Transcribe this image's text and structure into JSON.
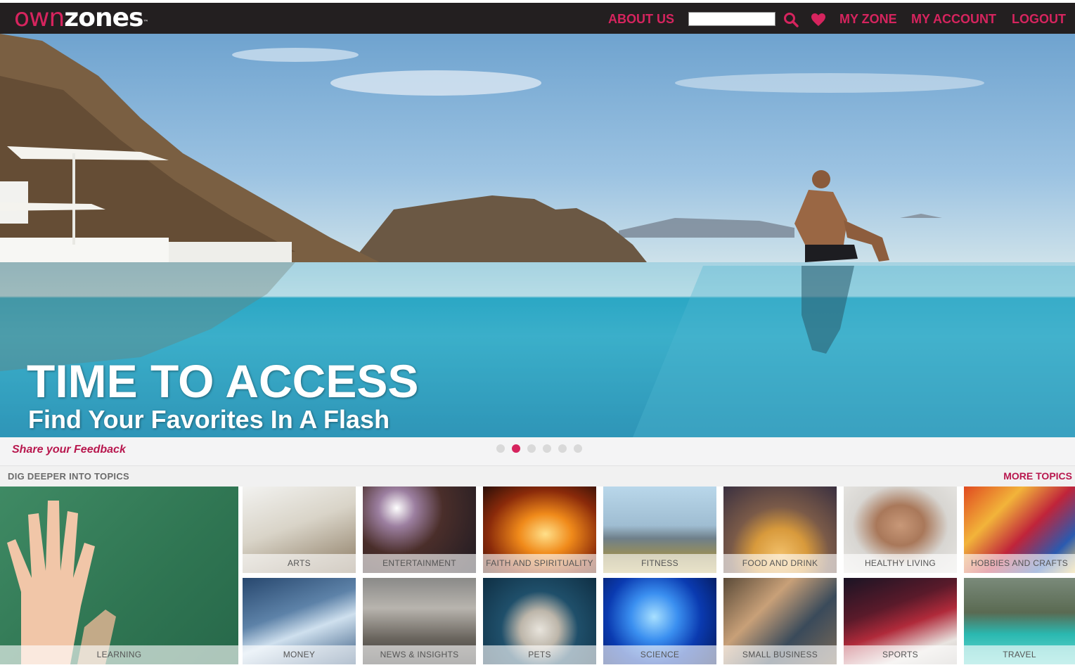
{
  "header": {
    "logo": {
      "own": "own",
      "zones": "zones",
      "tm": "™"
    },
    "nav": {
      "about_us": "ABOUT US",
      "my_zone": "MY ZONE",
      "my_account": "MY ACCOUNT",
      "logout": "LOGOUT"
    },
    "search": {
      "value": "",
      "placeholder": ""
    },
    "icons": {
      "search": "search-icon",
      "favorites": "heart-icon"
    }
  },
  "hero": {
    "title": "TIME TO ACCESS",
    "subtitle": "Find Your Favorites In A Flash"
  },
  "carousel": {
    "slide_count": 6,
    "active_index": 1
  },
  "feedback": {
    "label": "Share your Feedback"
  },
  "topics": {
    "heading": "DIG DEEPER INTO TOPICS",
    "more": "MORE TOPICS",
    "featured": {
      "label": "LEARNING"
    },
    "row1": [
      "ARTS",
      "ENTERTAINMENT",
      "FAITH AND SPIRITUALITY",
      "FITNESS",
      "FOOD AND DRINK",
      "HEALTHY LIVING",
      "HOBBIES AND CRAFTS"
    ],
    "row2": [
      "MONEY",
      "NEWS & INSIGHTS",
      "PETS",
      "SCIENCE",
      "SMALL BUSINESS",
      "SPORTS",
      "TRAVEL"
    ]
  },
  "colors": {
    "brand": "#d6245e",
    "header_bg": "#231f20",
    "feedback": "#b8174e"
  }
}
